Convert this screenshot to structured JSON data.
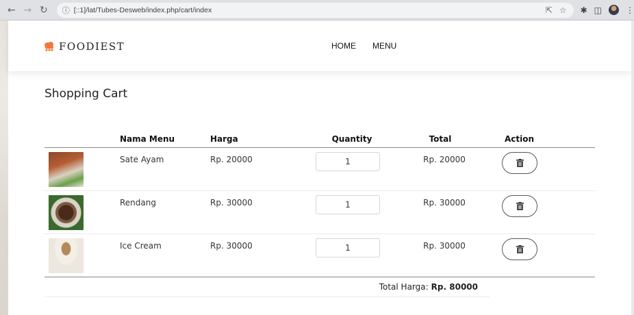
{
  "browser": {
    "url": "[::1]/lat/Tubes-Desweb/index.php/cart/index"
  },
  "brand": {
    "name": "FOODIEST",
    "accent": "#f07a3e"
  },
  "nav": {
    "items": [
      {
        "label": "HOME"
      },
      {
        "label": "MENU"
      }
    ]
  },
  "page": {
    "title": "Shopping Cart"
  },
  "cart": {
    "headers": {
      "name": "Nama Menu",
      "price": "Harga",
      "quantity": "Quantity",
      "total": "Total",
      "action": "Action"
    },
    "rows": [
      {
        "name": "Sate Ayam",
        "price": "Rp. 20000",
        "quantity": "1",
        "total": "Rp. 20000"
      },
      {
        "name": "Rendang",
        "price": "Rp. 30000",
        "quantity": "1",
        "total": "Rp. 30000"
      },
      {
        "name": "Ice Cream",
        "price": "Rp. 30000",
        "quantity": "1",
        "total": "Rp. 30000"
      }
    ],
    "total_label": "Total Harga:",
    "total_value": "Rp. 80000"
  }
}
